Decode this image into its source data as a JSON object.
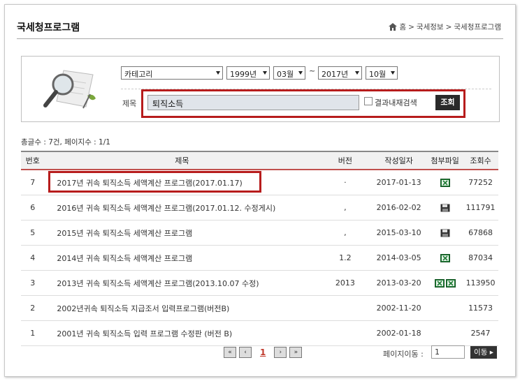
{
  "header": {
    "title": "국세청프로그램",
    "breadcrumb": [
      "홈",
      "국세정보",
      "국세청프로그램"
    ]
  },
  "filters": {
    "category": "카테고리",
    "from_year": "1999년",
    "from_month": "03월",
    "separator": "~",
    "to_year": "2017년",
    "to_month": "10월",
    "title_label": "제목",
    "title_value": "퇴직소득",
    "within_results_label": "결과내재검색",
    "search_button": "조회"
  },
  "summary": "총글수 : 7건, 페이지수 : 1/1",
  "table": {
    "headers": [
      "번호",
      "제목",
      "버전",
      "작성일자",
      "첨부파일",
      "조회수"
    ],
    "rows": [
      {
        "no": "7",
        "title": "2017년 귀속 퇴직소득 세액계산 프로그램(2017.01.17)",
        "version": "·",
        "date": "2017-01-13",
        "files": [
          "excel-file-icon"
        ],
        "views": "77252"
      },
      {
        "no": "6",
        "title": "2016년 귀속 퇴직소득 세액계산 프로그램(2017.01.12. 수정게시)",
        "version": ",",
        "date": "2016-02-02",
        "files": [
          "floppy-disk-icon"
        ],
        "views": "111791"
      },
      {
        "no": "5",
        "title": "2015년 귀속 퇴직소득 세액계산 프로그램",
        "version": ",",
        "date": "2015-03-10",
        "files": [
          "floppy-disk-icon"
        ],
        "views": "67868"
      },
      {
        "no": "4",
        "title": "2014년 귀속 퇴직소득 세액계산 프로그램",
        "version": "1.2",
        "date": "2014-03-05",
        "files": [
          "excel-file-icon"
        ],
        "views": "87034"
      },
      {
        "no": "3",
        "title": "2013년 귀속 퇴직소득 세액계산 프로그램(2013.10.07 수정)",
        "version": "2013",
        "date": "2013-03-20",
        "files": [
          "excel-file-icon",
          "excel-file-icon"
        ],
        "views": "113950"
      },
      {
        "no": "2",
        "title": "2002년귀속 퇴직소득 지급조서 입력프로그램(버전B)",
        "version": "",
        "date": "2002-11-20",
        "files": [],
        "views": "11573"
      },
      {
        "no": "1",
        "title": "2001년 귀속 퇴직소득 입력 프로그램 수정판 (버전 B)",
        "version": "",
        "date": "2002-01-18",
        "files": [],
        "views": "2547"
      }
    ]
  },
  "pagination": {
    "current_page": "1",
    "goto_label": "페이지이동 :",
    "goto_value": "1",
    "goto_button": "이동 ▸"
  },
  "colors": {
    "highlight": "#b71c1c",
    "header_border": "#c0504d",
    "button_dark": "#2a2a2a",
    "excel_green": "#1e7b34"
  }
}
